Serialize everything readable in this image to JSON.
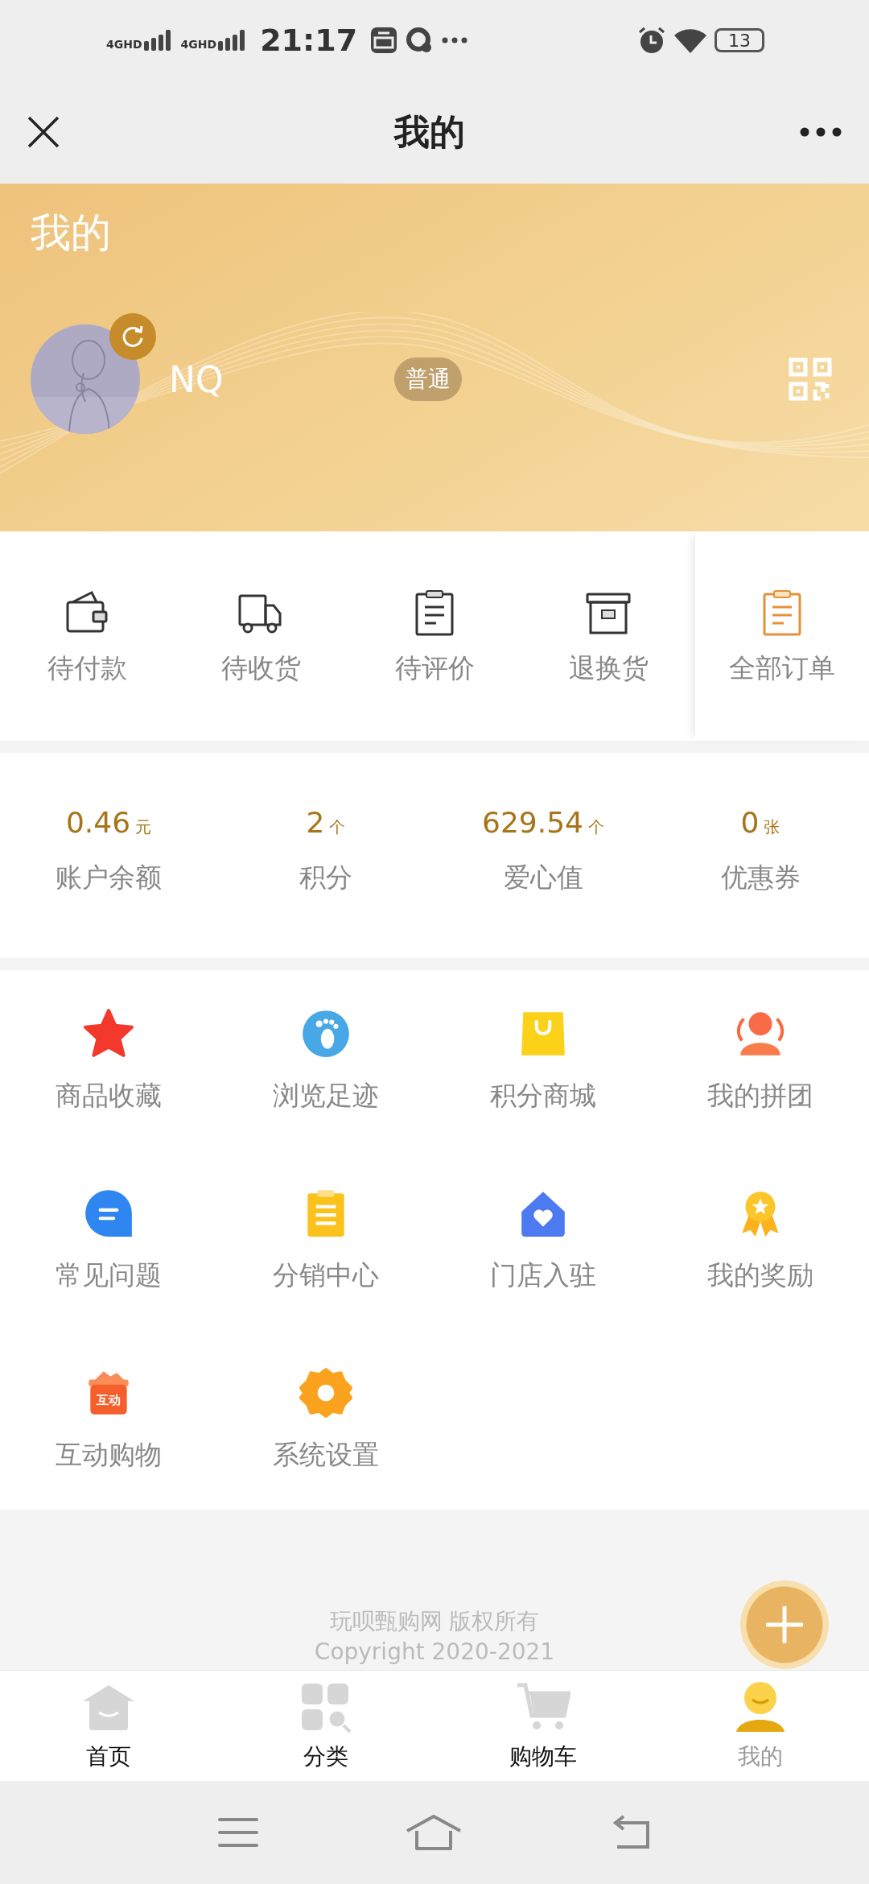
{
  "status_bar": {
    "signals": [
      "4GHD",
      "4GHD"
    ],
    "time": "21:17",
    "battery": "13"
  },
  "nav": {
    "title": "我的"
  },
  "profile": {
    "heading": "我的",
    "name": "NQ",
    "level_badge": "普通"
  },
  "orders": [
    {
      "kind": "status",
      "label": "待付款"
    },
    {
      "kind": "status",
      "label": "待收货"
    },
    {
      "kind": "status",
      "label": "待评价"
    },
    {
      "kind": "status",
      "label": "退换货"
    },
    {
      "kind": "all",
      "label": "全部订单"
    }
  ],
  "stats": [
    {
      "value": "0.46",
      "unit": "元",
      "label": "账户余额"
    },
    {
      "value": "2",
      "unit": "个",
      "label": "积分"
    },
    {
      "value": "629.54",
      "unit": "个",
      "label": "爱心值"
    },
    {
      "value": "0",
      "unit": "张",
      "label": "优惠券"
    }
  ],
  "services": [
    {
      "label": "商品收藏"
    },
    {
      "label": "浏览足迹"
    },
    {
      "label": "积分商城"
    },
    {
      "label": "我的拼团"
    },
    {
      "label": "常见问题"
    },
    {
      "label": "分销中心"
    },
    {
      "label": "门店入驻"
    },
    {
      "label": "我的奖励"
    },
    {
      "label": "互动购物",
      "icon_label": "互动"
    },
    {
      "label": "系统设置"
    }
  ],
  "footer": {
    "lines": [
      "玩呗甄购网 版权所有",
      "Copyright 2020-2021"
    ]
  },
  "tab_bar": [
    {
      "label": "首页",
      "selected": false
    },
    {
      "label": "分类",
      "selected": false
    },
    {
      "label": "购物车",
      "selected": false
    },
    {
      "label": "我的",
      "selected": true
    }
  ]
}
